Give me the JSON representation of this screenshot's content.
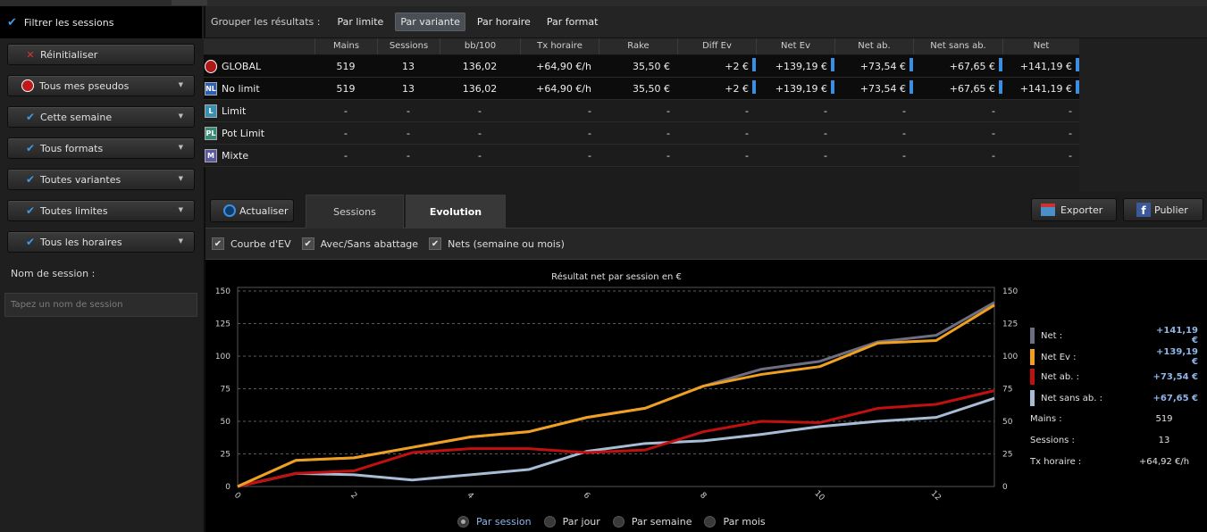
{
  "sidebar": {
    "title": "Filtrer les sessions",
    "reset": "Réinitialiser",
    "filters": [
      {
        "label": "Tous mes pseudos",
        "icon": "logo"
      },
      {
        "label": "Cette semaine",
        "icon": "tick"
      },
      {
        "label": "Tous formats",
        "icon": "tick"
      },
      {
        "label": "Toutes variantes",
        "icon": "tick"
      },
      {
        "label": "Toutes limites",
        "icon": "tick"
      },
      {
        "label": "Tous les horaires",
        "icon": "tick"
      }
    ],
    "session_label": "Nom de session :",
    "session_placeholder": "Tapez un nom de session"
  },
  "groupbar": {
    "label": "Grouper les résultats :",
    "options": [
      "Par limite",
      "Par variante",
      "Par horaire",
      "Par format"
    ],
    "active": "Par variante"
  },
  "table": {
    "headers": [
      "Mains",
      "Sessions",
      "bb/100",
      "Tx horaire",
      "Rake",
      "Diff Ev",
      "Net Ev",
      "Net ab.",
      "Net sans ab.",
      "Net"
    ],
    "rows": [
      {
        "badge": "G",
        "name": "GLOBAL",
        "cells": [
          "519",
          "13",
          "136,02",
          "+64,90 €/h",
          "35,50 €",
          "+2 €",
          "+139,19 €",
          "+73,54 €",
          "+67,65 €",
          "+141,19 €"
        ]
      },
      {
        "badge": "NL",
        "name": "No limit",
        "cells": [
          "519",
          "13",
          "136,02",
          "+64,90 €/h",
          "35,50 €",
          "+2 €",
          "+139,19 €",
          "+73,54 €",
          "+67,65 €",
          "+141,19 €"
        ]
      },
      {
        "badge": "L",
        "name": "Limit",
        "cells": [
          "-",
          "-",
          "-",
          "-",
          "-",
          "-",
          "-",
          "-",
          "-",
          "-"
        ]
      },
      {
        "badge": "PL",
        "name": "Pot Limit",
        "cells": [
          "-",
          "-",
          "-",
          "-",
          "-",
          "-",
          "-",
          "-",
          "-",
          "-"
        ]
      },
      {
        "badge": "M",
        "name": "Mixte",
        "cells": [
          "-",
          "-",
          "-",
          "-",
          "-",
          "-",
          "-",
          "-",
          "-",
          "-"
        ]
      }
    ]
  },
  "toolbar": {
    "refresh": "Actualiser",
    "tabs": [
      "Sessions",
      "Evolution"
    ],
    "active_tab": "Evolution",
    "export": "Exporter",
    "publish": "Publier"
  },
  "options": [
    {
      "label": "Courbe d'EV",
      "checked": true
    },
    {
      "label": "Avec/Sans abattage",
      "checked": true
    },
    {
      "label": "Nets (semaine ou mois)",
      "checked": true
    }
  ],
  "chart_data": {
    "type": "line",
    "title": "Résultat net par session en €",
    "xlabel": "",
    "ylabel": "",
    "xlim": [
      0,
      13
    ],
    "ylim": [
      0,
      150
    ],
    "x_ticks": [
      0,
      2,
      4,
      6,
      8,
      10,
      12
    ],
    "y_ticks": [
      0,
      25,
      50,
      75,
      100,
      125,
      150
    ],
    "grid": true,
    "legend_position": "right",
    "x": [
      0,
      1,
      2,
      3,
      4,
      5,
      6,
      7,
      8,
      9,
      10,
      11,
      12,
      13
    ],
    "series": [
      {
        "name": "Net :",
        "color": "#6e6e82",
        "values": [
          0,
          20,
          22,
          30,
          38,
          42,
          53,
          60,
          77,
          90,
          96,
          111,
          116,
          141.19
        ]
      },
      {
        "name": "Net Ev :",
        "color": "#f0a020",
        "values": [
          0,
          20,
          22,
          30,
          38,
          42,
          53,
          60,
          77,
          86,
          92,
          110,
          112,
          139.19
        ]
      },
      {
        "name": "Net ab. :",
        "color": "#c01010",
        "values": [
          0,
          10,
          12,
          26,
          29,
          29,
          26,
          28,
          42,
          50,
          49,
          60,
          63,
          73.54
        ]
      },
      {
        "name": "Net sans ab. :",
        "color": "#a8bcd6",
        "values": [
          0,
          10,
          9,
          5,
          9,
          13,
          27,
          33,
          35,
          40,
          46,
          50,
          53,
          67.65
        ]
      }
    ]
  },
  "legend": {
    "values": [
      "+141,19 €",
      "+139,19 €",
      "+73,54 €",
      "+67,65 €"
    ],
    "stats": [
      {
        "label": "Mains :",
        "value": "519"
      },
      {
        "label": "Sessions :",
        "value": "13"
      },
      {
        "label": "Tx horaire :",
        "value": "+64,92 €/h"
      }
    ]
  },
  "radios": {
    "options": [
      "Par session",
      "Par jour",
      "Par semaine",
      "Par mois"
    ],
    "selected": "Par session"
  }
}
